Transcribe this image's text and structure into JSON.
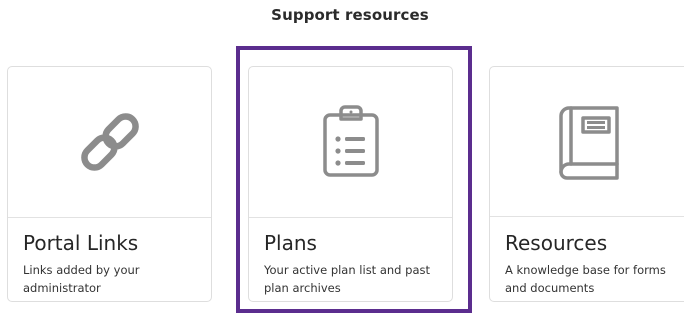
{
  "section": {
    "title": "Support resources"
  },
  "cards": [
    {
      "title": "Portal Links",
      "description": "Links added by your administrator",
      "icon": "link-icon"
    },
    {
      "title": "Plans",
      "description": "Your active plan list and past plan archives",
      "icon": "clipboard-list-icon",
      "focused": true
    },
    {
      "title": "Resources",
      "description": "A knowledge base for forms and documents",
      "icon": "book-icon"
    }
  ],
  "colors": {
    "focus_ring": "#5b2d8e",
    "icon_gray": "#8c8c8c",
    "card_border": "#dedede"
  }
}
